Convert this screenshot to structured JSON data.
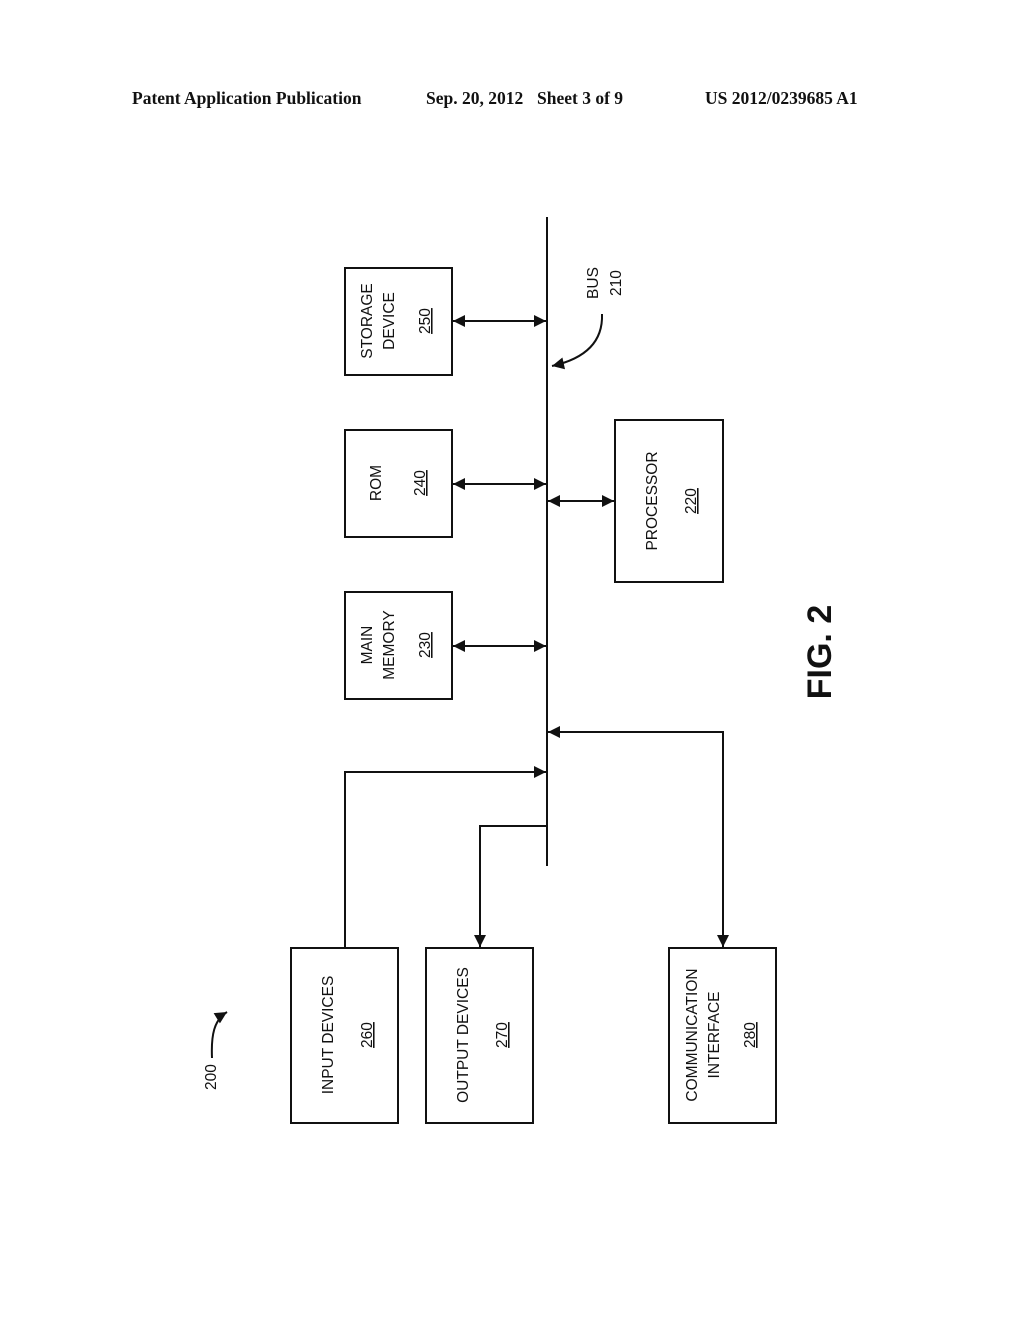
{
  "header": {
    "publication": "Patent Application Publication",
    "date": "Sep. 20, 2012",
    "sheet": "Sheet 3 of 9",
    "number": "US 2012/0239685 A1"
  },
  "figure": {
    "label": "FIG. 2",
    "ref": "200",
    "bus": {
      "name": "BUS",
      "ref": "210"
    },
    "blocks": {
      "storage": {
        "lines": [
          "STORAGE",
          "DEVICE"
        ],
        "ref": "250"
      },
      "rom": {
        "lines": [
          "ROM"
        ],
        "ref": "240"
      },
      "main_memory": {
        "lines": [
          "MAIN",
          "MEMORY"
        ],
        "ref": "230"
      },
      "processor": {
        "lines": [
          "PROCESSOR"
        ],
        "ref": "220"
      },
      "input": {
        "lines": [
          "INPUT DEVICES"
        ],
        "ref": "260"
      },
      "output": {
        "lines": [
          "OUTPUT DEVICES"
        ],
        "ref": "270"
      },
      "comm": {
        "lines": [
          "COMMUNICATION",
          "INTERFACE"
        ],
        "ref": "280"
      }
    },
    "connections": [
      {
        "from": "storage",
        "to": "bus",
        "direction": "bidirectional"
      },
      {
        "from": "rom",
        "to": "bus",
        "direction": "bidirectional"
      },
      {
        "from": "main_memory",
        "to": "bus",
        "direction": "bidirectional"
      },
      {
        "from": "processor",
        "to": "bus",
        "direction": "bidirectional"
      },
      {
        "from": "input",
        "to": "bus",
        "direction": "to-bus"
      },
      {
        "from": "bus",
        "to": "output",
        "direction": "from-bus"
      },
      {
        "from": "comm",
        "to": "bus",
        "direction": "bidirectional"
      }
    ]
  }
}
